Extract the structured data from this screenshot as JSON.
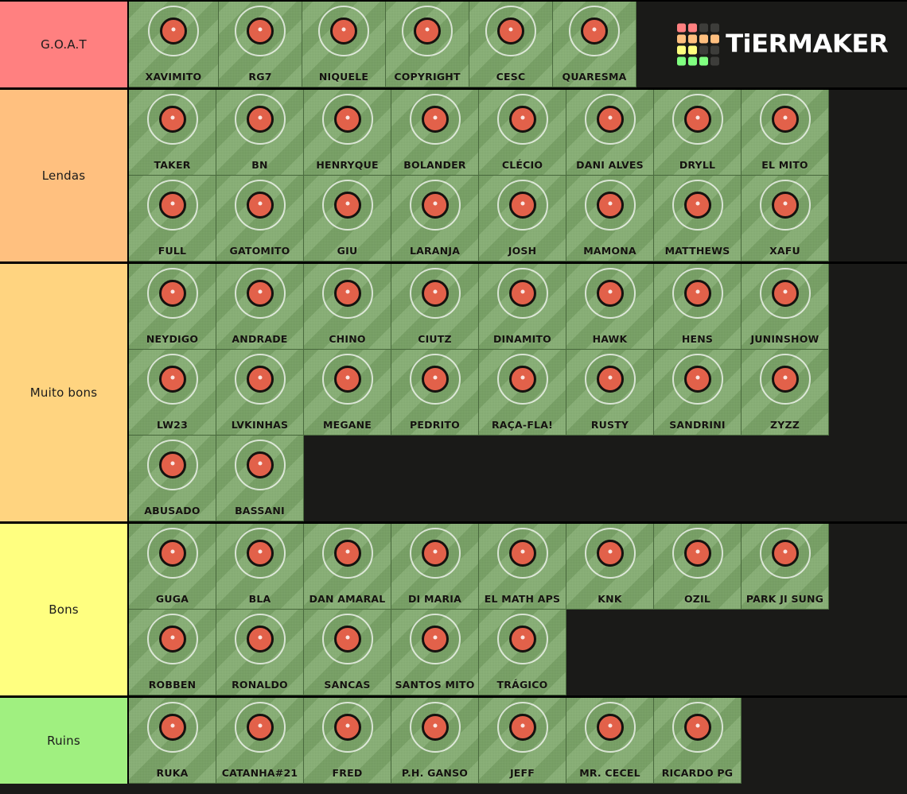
{
  "app": {
    "name": "TierMaker",
    "logo_text": "TiERMAKER",
    "background_color": "#1a1a18"
  },
  "logo_grid_colors": [
    "#ff8080",
    "#ff8080",
    "#3d3d3a",
    "#3d3d3a",
    "#ffbf7f",
    "#ffbf7f",
    "#ffbf7f",
    "#ffbf7f",
    "#ffff7f",
    "#ffff7f",
    "#3d3d3a",
    "#3d3d3a",
    "#80ff80",
    "#80ff80",
    "#80ff80",
    "#3d3d3a"
  ],
  "card_style": {
    "field_color": "#7fab6b",
    "ball_color": "#e2614a",
    "ball_outline": "#15120f",
    "ring_color": "#ffffff"
  },
  "tiers": [
    {
      "label": "G.O.A.T",
      "color": "#ff8080",
      "rows": [
        [
          {
            "name": "XAVIMITO",
            "w": 113
          },
          {
            "name": "RG7",
            "w": 105
          },
          {
            "name": "NIQUELE",
            "w": 105
          },
          {
            "name": "COPYRIGHT",
            "w": 105
          },
          {
            "name": "CESC",
            "w": 105
          },
          {
            "name": "QUARESMA",
            "w": 105
          }
        ]
      ]
    },
    {
      "label": "Lendas",
      "color": "#ffc07f",
      "rows": [
        [
          {
            "name": "TAKER",
            "w": 110
          },
          {
            "name": "BN",
            "w": 110
          },
          {
            "name": "HENRYQUE",
            "w": 110
          },
          {
            "name": "BOLANDER",
            "w": 110
          },
          {
            "name": "CLÉCIO",
            "w": 110
          },
          {
            "name": "DANI ALVES",
            "w": 110
          },
          {
            "name": "DRYLL",
            "w": 110
          },
          {
            "name": "EL MITO",
            "w": 110
          }
        ],
        [
          {
            "name": "FULL",
            "w": 110
          },
          {
            "name": "GATOMITO",
            "w": 110
          },
          {
            "name": "GIU",
            "w": 110
          },
          {
            "name": "LARANJA",
            "w": 110
          },
          {
            "name": "JOSH",
            "w": 110
          },
          {
            "name": "MAMONA",
            "w": 110
          },
          {
            "name": "MATTHEWS",
            "w": 110
          },
          {
            "name": "XAFU",
            "w": 110
          }
        ]
      ]
    },
    {
      "label": "Muito bons",
      "color": "#ffd480",
      "rows": [
        [
          {
            "name": "NEYDIGO",
            "w": 110
          },
          {
            "name": "ANDRADE",
            "w": 110
          },
          {
            "name": "CHINO",
            "w": 110
          },
          {
            "name": "CIUTZ",
            "w": 110
          },
          {
            "name": "DINAMITO",
            "w": 110
          },
          {
            "name": "HAWK",
            "w": 110
          },
          {
            "name": "HENS",
            "w": 110
          },
          {
            "name": "JUNINSHOW",
            "w": 110
          }
        ],
        [
          {
            "name": "LW23",
            "w": 110
          },
          {
            "name": "LVKINHAS",
            "w": 110
          },
          {
            "name": "MEGANE",
            "w": 110
          },
          {
            "name": "PEDRITO",
            "w": 110
          },
          {
            "name": "RAÇA-FLA!",
            "w": 110
          },
          {
            "name": "RUSTY",
            "w": 110
          },
          {
            "name": "SANDRINI",
            "w": 110
          },
          {
            "name": "ZYZZ",
            "w": 110
          }
        ],
        [
          {
            "name": "ABUSADO",
            "w": 110
          },
          {
            "name": "BASSANI",
            "w": 110
          }
        ]
      ]
    },
    {
      "label": "Bons",
      "color": "#ffff80",
      "rows": [
        [
          {
            "name": "GUGA",
            "w": 110
          },
          {
            "name": "BLA",
            "w": 110
          },
          {
            "name": "DAN AMARAL",
            "w": 110
          },
          {
            "name": "DI MARIA",
            "w": 110
          },
          {
            "name": "EL MATH APS",
            "w": 110
          },
          {
            "name": "KNK",
            "w": 110
          },
          {
            "name": "OZIL",
            "w": 110
          },
          {
            "name": "PARK JI SUNG",
            "w": 110
          }
        ],
        [
          {
            "name": "ROBBEN",
            "w": 110
          },
          {
            "name": "RONALDO",
            "w": 110
          },
          {
            "name": "SANCAS",
            "w": 110
          },
          {
            "name": "SANTOS MITO",
            "w": 110
          },
          {
            "name": "TRÁGICO",
            "w": 110
          }
        ]
      ]
    },
    {
      "label": "Ruins",
      "color": "#a0f080",
      "rows": [
        [
          {
            "name": "RUKA",
            "w": 110
          },
          {
            "name": "CATANHA#21",
            "w": 110
          },
          {
            "name": "FRED",
            "w": 110
          },
          {
            "name": "P.H. GANSO",
            "w": 110
          },
          {
            "name": "JEFF",
            "w": 110
          },
          {
            "name": "MR. CECEL",
            "w": 110
          },
          {
            "name": "RICARDO PG",
            "w": 110
          }
        ]
      ]
    }
  ]
}
